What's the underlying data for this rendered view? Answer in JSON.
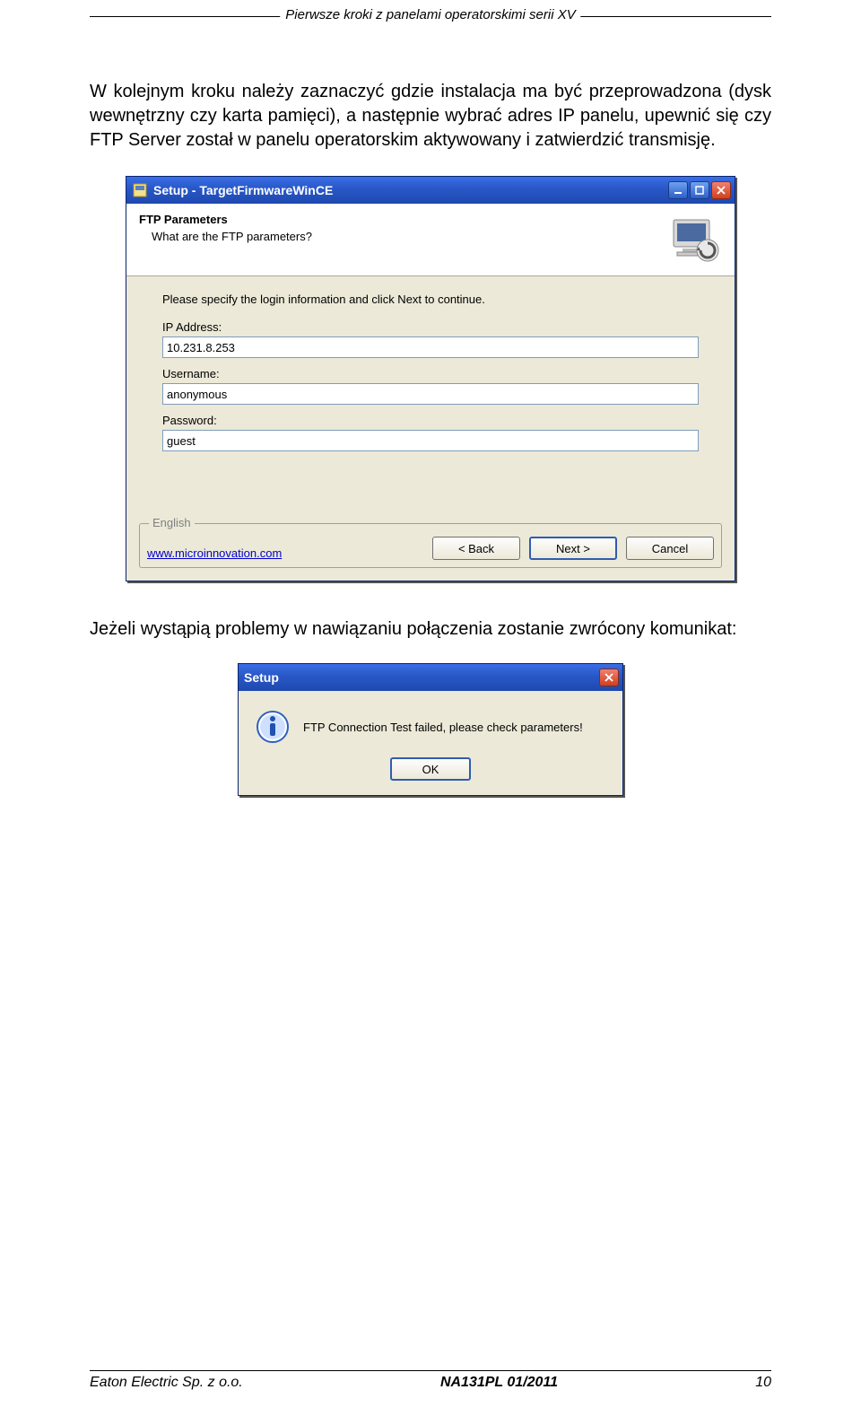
{
  "header": "Pierwsze kroki z panelami operatorskimi serii XV",
  "body_text": "W kolejnym kroku należy zaznaczyć gdzie instalacja ma być przeprowadzona (dysk wewnętrzny czy karta pamięci), a następnie wybrać adres IP panelu, upewnić się czy FTP Server został w panelu operatorskim aktywowany i zatwierdzić transmisję.",
  "setup": {
    "title": "Setup - TargetFirmwareWinCE",
    "header_title": "FTP Parameters",
    "header_sub": "What are the FTP parameters?",
    "intro": "Please specify the login information and click Next to continue.",
    "ip_label": "IP Address:",
    "ip_value": "10.231.8.253",
    "user_label": "Username:",
    "user_value": "anonymous",
    "pass_label": "Password:",
    "pass_value": "guest",
    "lang": "English",
    "link": "www.microinnovation.com",
    "back": "< Back",
    "next": "Next >",
    "cancel": "Cancel"
  },
  "text_after": "Jeżeli wystąpią problemy w nawiązaniu połączenia zostanie zwrócony komunikat:",
  "msgbox": {
    "title": "Setup",
    "text": "FTP Connection Test failed, please check parameters!",
    "ok": "OK"
  },
  "footer": {
    "left": "Eaton Electric Sp. z o.o.",
    "center": "NA131PL 01/2011",
    "right": "10"
  }
}
